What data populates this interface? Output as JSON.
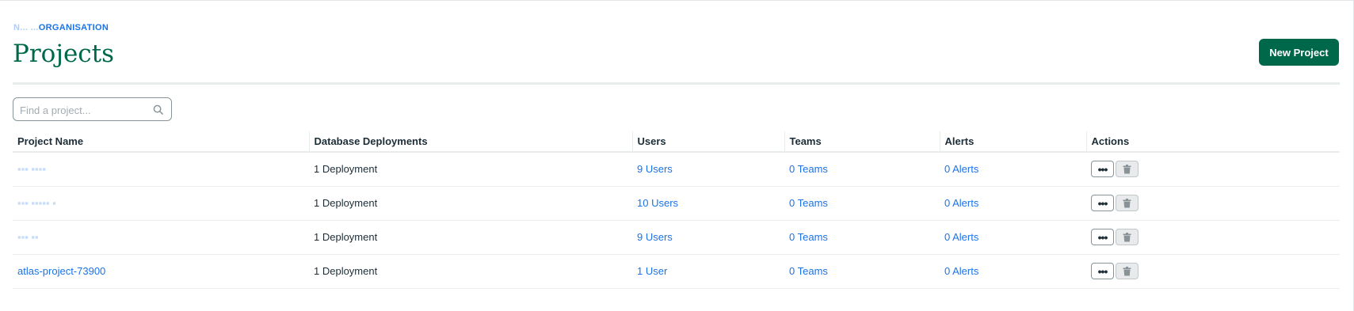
{
  "breadcrumb": {
    "masked_prefix": "N... ...",
    "label": "ORGANISATION"
  },
  "page_title": "Projects",
  "new_project_button": "New Project",
  "search": {
    "placeholder": "Find a project...",
    "value": ""
  },
  "table": {
    "headers": [
      "Project Name",
      "Database Deployments",
      "Users",
      "Teams",
      "Alerts",
      "Actions"
    ],
    "rows": [
      {
        "name": "",
        "deployments": "1 Deployment",
        "users": "9 Users",
        "teams": "0 Teams",
        "alerts": "0 Alerts"
      },
      {
        "name": "",
        "deployments": "1 Deployment",
        "users": "10 Users",
        "teams": "0 Teams",
        "alerts": "0 Alerts"
      },
      {
        "name": "",
        "deployments": "1 Deployment",
        "users": "9 Users",
        "teams": "0 Teams",
        "alerts": "0 Alerts"
      },
      {
        "name": "atlas-project-73900",
        "deployments": "1 Deployment",
        "users": "1 User",
        "teams": "0 Teams",
        "alerts": "0 Alerts"
      }
    ]
  },
  "icons": {
    "search": "search-icon",
    "more": "ellipsis-icon",
    "delete": "trash-icon"
  },
  "colors": {
    "brand_green": "#00684a",
    "link_blue": "#1a73e8"
  }
}
